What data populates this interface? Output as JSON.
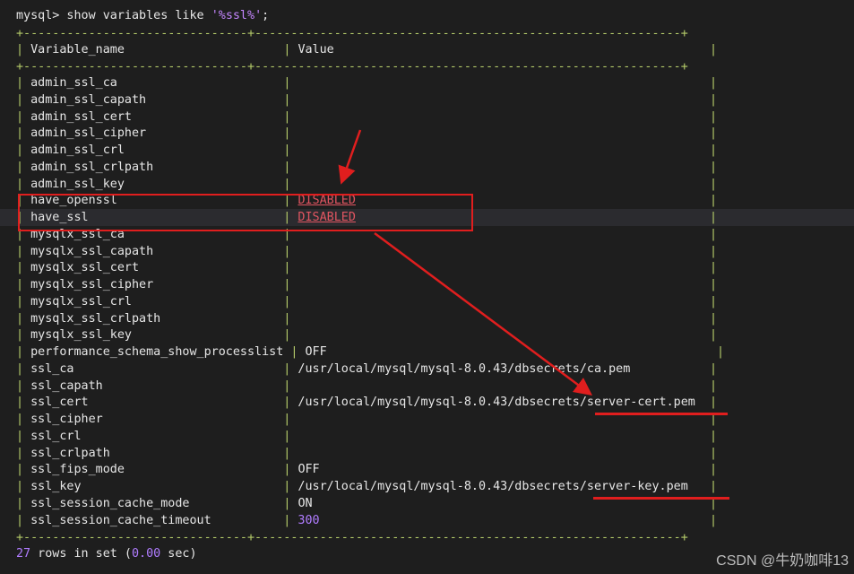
{
  "command": {
    "prompt": "mysql>",
    "sql_before": " show variables like ",
    "sql_quote_open": "'",
    "sql_pct1": "%",
    "sql_word": "ssl",
    "sql_pct2": "%",
    "sql_quote_close": "'",
    "sql_end": ";"
  },
  "table": {
    "border_line": "+-------------------------------+-----------------------------------------------------------+",
    "header": {
      "col1": "Variable_name",
      "col2": "Value"
    },
    "rows": [
      {
        "name": "admin_ssl_ca",
        "value": ""
      },
      {
        "name": "admin_ssl_capath",
        "value": ""
      },
      {
        "name": "admin_ssl_cert",
        "value": ""
      },
      {
        "name": "admin_ssl_cipher",
        "value": ""
      },
      {
        "name": "admin_ssl_crl",
        "value": ""
      },
      {
        "name": "admin_ssl_crlpath",
        "value": ""
      },
      {
        "name": "admin_ssl_key",
        "value": ""
      },
      {
        "name": "have_openssl",
        "value": "DISABLED"
      },
      {
        "name": "have_ssl",
        "value": "DISABLED"
      },
      {
        "name": "mysqlx_ssl_ca",
        "value": ""
      },
      {
        "name": "mysqlx_ssl_capath",
        "value": ""
      },
      {
        "name": "mysqlx_ssl_cert",
        "value": ""
      },
      {
        "name": "mysqlx_ssl_cipher",
        "value": ""
      },
      {
        "name": "mysqlx_ssl_crl",
        "value": ""
      },
      {
        "name": "mysqlx_ssl_crlpath",
        "value": ""
      },
      {
        "name": "mysqlx_ssl_key",
        "value": ""
      },
      {
        "name": "performance_schema_show_processlist",
        "value": "OFF"
      },
      {
        "name": "ssl_ca",
        "value": "/usr/local/mysql/mysql-8.0.43/dbsecrets/ca.pem"
      },
      {
        "name": "ssl_capath",
        "value": ""
      },
      {
        "name": "ssl_cert",
        "value": "/usr/local/mysql/mysql-8.0.43/dbsecrets/server-cert.pem"
      },
      {
        "name": "ssl_cipher",
        "value": ""
      },
      {
        "name": "ssl_crl",
        "value": ""
      },
      {
        "name": "ssl_crlpath",
        "value": ""
      },
      {
        "name": "ssl_fips_mode",
        "value": "OFF"
      },
      {
        "name": "ssl_key",
        "value": "/usr/local/mysql/mysql-8.0.43/dbsecrets/server-key.pem"
      },
      {
        "name": "ssl_session_cache_mode",
        "value": "ON"
      },
      {
        "name": "ssl_session_cache_timeout",
        "value": "300"
      }
    ]
  },
  "footer": {
    "count": "27",
    "text_mid": " rows in set (",
    "time": "0.00",
    "text_end": " sec)"
  },
  "watermark": "CSDN @牛奶咖啡13",
  "colors": {
    "background": "#1e1e1e",
    "text": "#e6e6e6",
    "border": "#b5cc6a",
    "disabled": "#e05561",
    "annotation_red": "#e01e1e",
    "number": "#b07cff"
  }
}
